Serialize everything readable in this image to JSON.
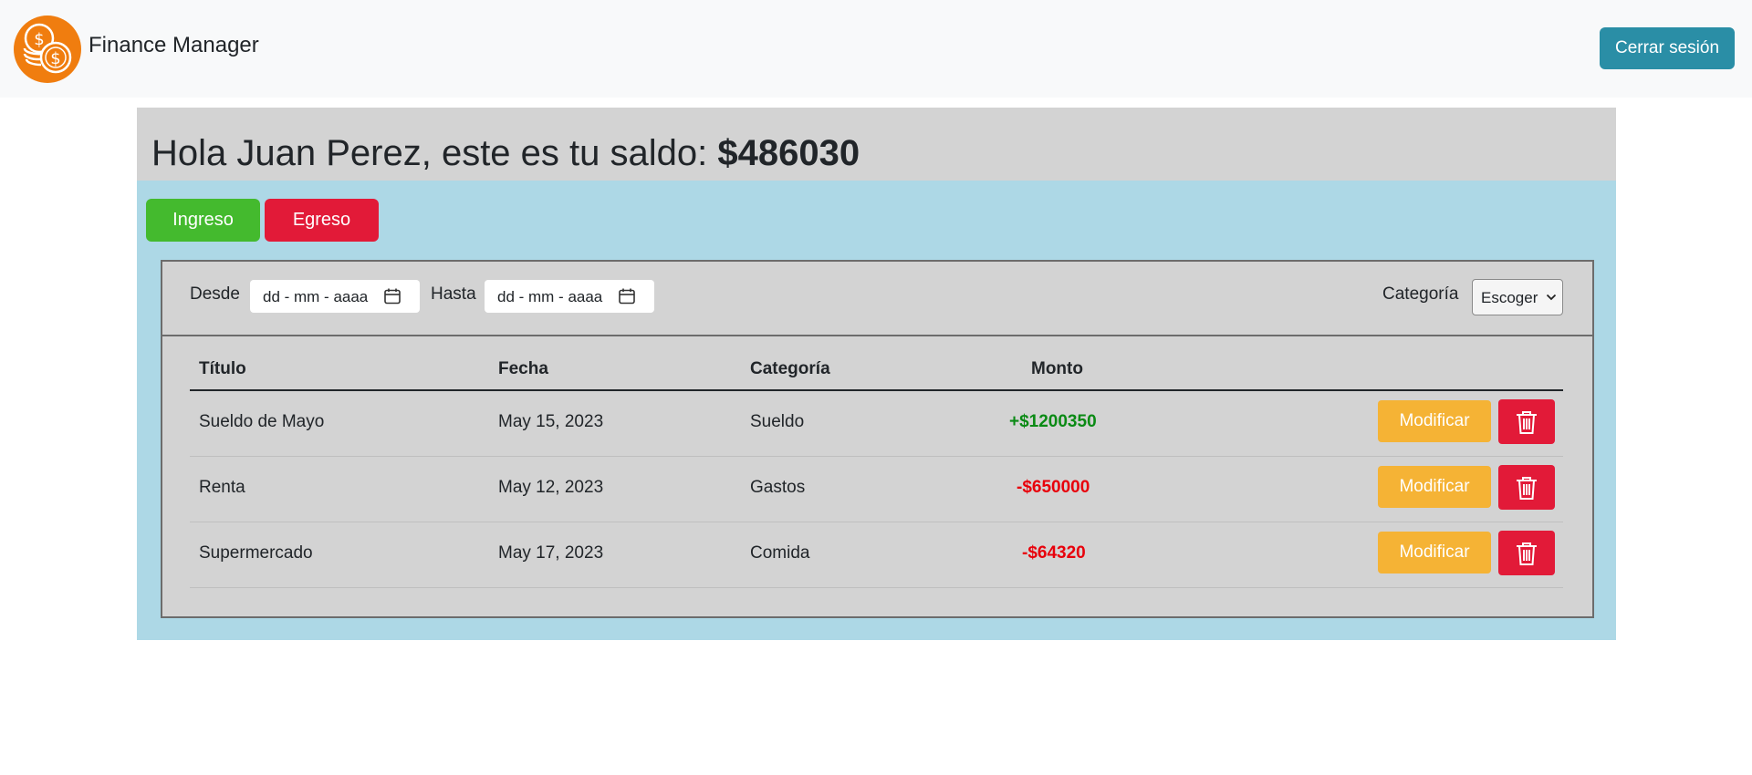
{
  "navbar": {
    "brand": "Finance Manager",
    "logo_icon": "coins-logo",
    "logout_label": "Cerrar sesión"
  },
  "greeting": {
    "text": "Hola Juan Perez, este es tu saldo: ",
    "balance": "$486030"
  },
  "actions": {
    "income_label": "Ingreso",
    "expense_label": "Egreso"
  },
  "filters": {
    "from_label": "Desde",
    "from_value": "dd - mm - aaaa",
    "to_label": "Hasta",
    "to_value": "dd - mm - aaaa",
    "category_label": "Categoría",
    "category_selected": "Escoger"
  },
  "table": {
    "columns": [
      "Título",
      "Fecha",
      "Categoría",
      "Monto"
    ],
    "rows": [
      {
        "title": "Sueldo de Mayo",
        "date": "May 15, 2023",
        "category": "Sueldo",
        "amount": "+$1200350",
        "modify_label": "Modificar"
      },
      {
        "title": "Renta",
        "date": "May 12, 2023",
        "category": "Gastos",
        "amount": "-$650000",
        "modify_label": "Modificar"
      },
      {
        "title": "Supermercado",
        "date": "May 17, 2023",
        "category": "Comida",
        "amount": "-$64320",
        "modify_label": "Modificar"
      }
    ]
  },
  "colors": {
    "income": "#44ba2e",
    "expense": "#e21a38",
    "modify": "#f5b335",
    "logout": "#2a8ea6",
    "card_bg": "#add8e6",
    "panel_bg": "#d3d3d3",
    "positive_amount": "#0a8a14",
    "negative_amount": "#e8000b"
  }
}
